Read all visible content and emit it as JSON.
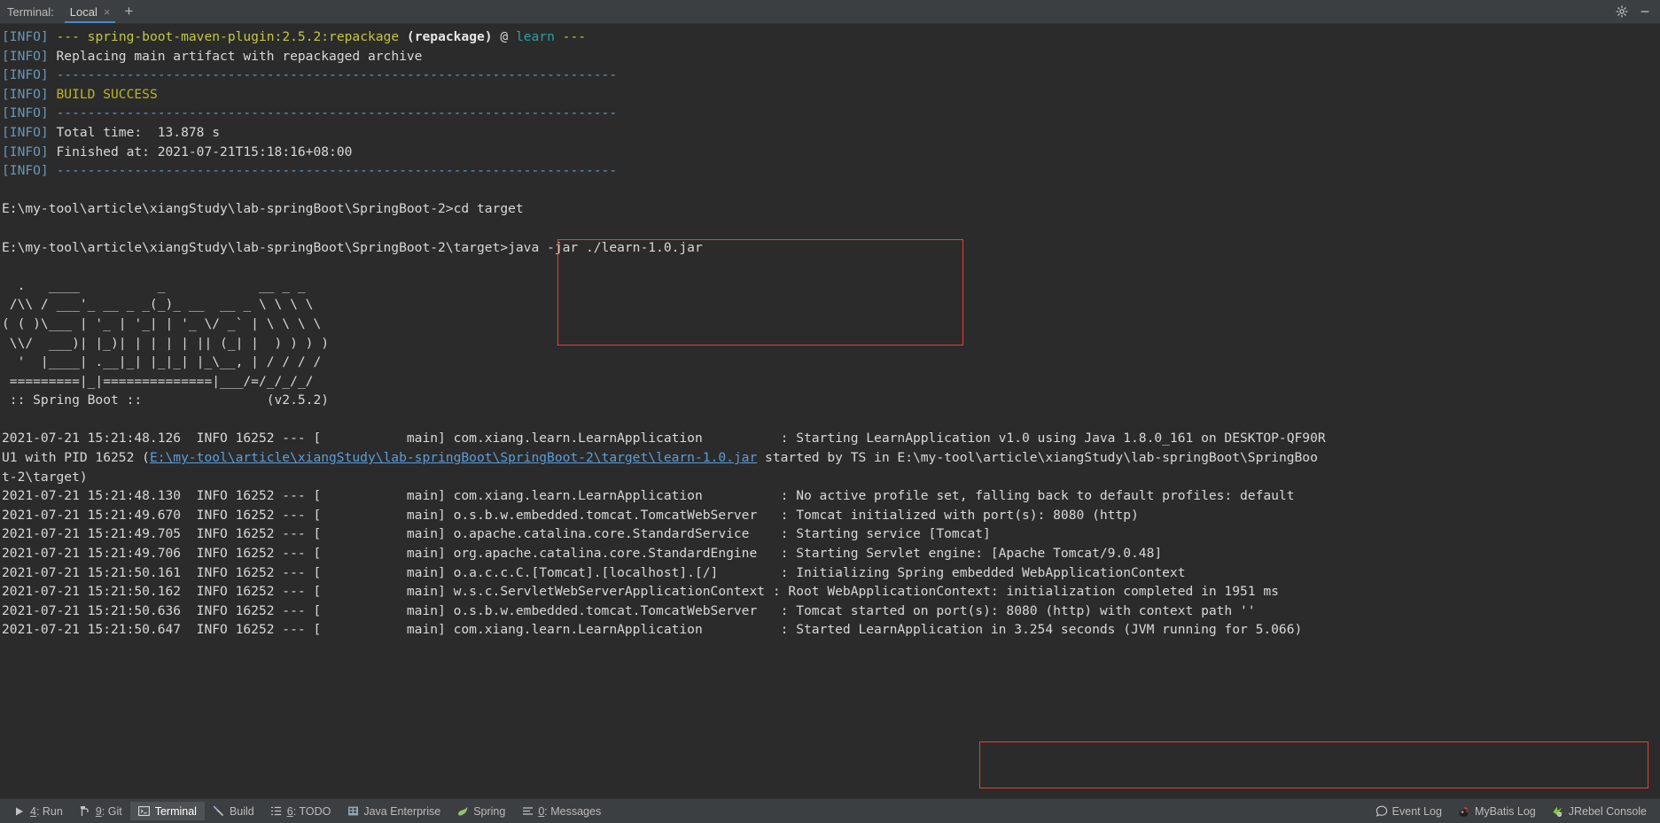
{
  "window": {
    "tabbar_label": "Terminal:",
    "tabs": [
      {
        "label": "Local",
        "close": "×",
        "active": true
      }
    ],
    "add_tab": "+",
    "settings_icon": "gear-icon",
    "minimize_icon": "minimize-icon"
  },
  "terminal": {
    "lines": [
      {
        "id": "l1",
        "segments": [
          {
            "t": "[INFO] ",
            "c": "c-info"
          },
          {
            "t": "--- ",
            "c": "c-plugin"
          },
          {
            "t": "spring-boot-maven-plugin:2.5.2:repackage",
            "c": "c-plugin"
          },
          {
            "t": " ",
            "c": "c-white"
          },
          {
            "t": "(repackage)",
            "c": "c-bold"
          },
          {
            "t": " @ ",
            "c": "c-white"
          },
          {
            "t": "learn",
            "c": "c-cyan"
          },
          {
            "t": " ---",
            "c": "c-plugin"
          }
        ]
      },
      {
        "id": "l2",
        "segments": [
          {
            "t": "[INFO] ",
            "c": "c-info"
          },
          {
            "t": "Replacing main artifact with repackaged archive",
            "c": "c-white"
          }
        ]
      },
      {
        "id": "l3",
        "segments": [
          {
            "t": "[INFO] ",
            "c": "c-info"
          },
          {
            "t": "------------------------------------------------------------------------",
            "c": "c-dash"
          }
        ]
      },
      {
        "id": "l4",
        "segments": [
          {
            "t": "[INFO] ",
            "c": "c-info"
          },
          {
            "t": "BUILD SUCCESS",
            "c": "c-yellow"
          }
        ]
      },
      {
        "id": "l5",
        "segments": [
          {
            "t": "[INFO] ",
            "c": "c-info"
          },
          {
            "t": "------------------------------------------------------------------------",
            "c": "c-dash"
          }
        ]
      },
      {
        "id": "l6",
        "segments": [
          {
            "t": "[INFO] ",
            "c": "c-info"
          },
          {
            "t": "Total time:  13.878 s",
            "c": "c-white"
          }
        ]
      },
      {
        "id": "l7",
        "segments": [
          {
            "t": "[INFO] ",
            "c": "c-info"
          },
          {
            "t": "Finished at: 2021-07-21T15:18:16+08:00",
            "c": "c-white"
          }
        ]
      },
      {
        "id": "l8",
        "segments": [
          {
            "t": "[INFO] ",
            "c": "c-info"
          },
          {
            "t": "------------------------------------------------------------------------",
            "c": "c-dash"
          }
        ]
      },
      {
        "id": "l9",
        "segments": [
          {
            "t": "",
            "c": "c-white"
          }
        ]
      },
      {
        "id": "l10",
        "segments": [
          {
            "t": "E:\\my-tool\\article\\xiangStudy\\lab-springBoot\\SpringBoot-2>cd target",
            "c": "c-white"
          }
        ]
      },
      {
        "id": "l11",
        "segments": [
          {
            "t": "",
            "c": "c-white"
          }
        ]
      },
      {
        "id": "l12",
        "segments": [
          {
            "t": "E:\\my-tool\\article\\xiangStudy\\lab-springBoot\\SpringBoot-2\\target>java -jar ./learn-1.0.jar",
            "c": "c-white"
          }
        ]
      },
      {
        "id": "l13",
        "segments": [
          {
            "t": "",
            "c": "c-white"
          }
        ]
      },
      {
        "id": "l14",
        "segments": [
          {
            "t": "  .   ____          _            __ _ _",
            "c": "c-white"
          }
        ]
      },
      {
        "id": "l15",
        "segments": [
          {
            "t": " /\\\\ / ___'_ __ _ _(_)_ __  __ _ \\ \\ \\ \\",
            "c": "c-white"
          }
        ]
      },
      {
        "id": "l16",
        "segments": [
          {
            "t": "( ( )\\___ | '_ | '_| | '_ \\/ _` | \\ \\ \\ \\",
            "c": "c-white"
          }
        ]
      },
      {
        "id": "l17",
        "segments": [
          {
            "t": " \\\\/  ___)| |_)| | | | | || (_| |  ) ) ) )",
            "c": "c-white"
          }
        ]
      },
      {
        "id": "l18",
        "segments": [
          {
            "t": "  '  |____| .__|_| |_|_| |_\\__, | / / / /",
            "c": "c-white"
          }
        ]
      },
      {
        "id": "l19",
        "segments": [
          {
            "t": " =========|_|==============|___/=/_/_/_/",
            "c": "c-white"
          }
        ]
      },
      {
        "id": "l20",
        "segments": [
          {
            "t": " :: Spring Boot ::                (v2.5.2)",
            "c": "c-white"
          }
        ]
      },
      {
        "id": "l21",
        "segments": [
          {
            "t": "",
            "c": "c-white"
          }
        ]
      },
      {
        "id": "l22",
        "segments": [
          {
            "t": "2021-07-21 15:21:48.126  INFO 16252 --- [           main] com.xiang.learn.LearnApplication          : Starting LearnApplication v1.0 using Java 1.8.0_161 on DESKTOP-QF90R",
            "c": "c-white"
          }
        ]
      },
      {
        "id": "l23",
        "segments": [
          {
            "t": "U1 with PID 16252 (",
            "c": "c-white"
          },
          {
            "t": "E:\\my-tool\\article\\xiangStudy\\lab-springBoot\\SpringBoot-2\\target\\learn-1.0.jar",
            "c": "c-link"
          },
          {
            "t": " started by TS in E:\\my-tool\\article\\xiangStudy\\lab-springBoot\\SpringBoo",
            "c": "c-white"
          }
        ]
      },
      {
        "id": "l24",
        "segments": [
          {
            "t": "t-2\\target)",
            "c": "c-white"
          }
        ]
      },
      {
        "id": "l25",
        "segments": [
          {
            "t": "2021-07-21 15:21:48.130  INFO 16252 --- [           main] com.xiang.learn.LearnApplication          : No active profile set, falling back to default profiles: default",
            "c": "c-white"
          }
        ]
      },
      {
        "id": "l26",
        "segments": [
          {
            "t": "2021-07-21 15:21:49.670  INFO 16252 --- [           main] o.s.b.w.embedded.tomcat.TomcatWebServer   : Tomcat initialized with port(s): 8080 (http)",
            "c": "c-white"
          }
        ]
      },
      {
        "id": "l27",
        "segments": [
          {
            "t": "2021-07-21 15:21:49.705  INFO 16252 --- [           main] o.apache.catalina.core.StandardService    : Starting service [Tomcat]",
            "c": "c-white"
          }
        ]
      },
      {
        "id": "l28",
        "segments": [
          {
            "t": "2021-07-21 15:21:49.706  INFO 16252 --- [           main] org.apache.catalina.core.StandardEngine   : Starting Servlet engine: [Apache Tomcat/9.0.48]",
            "c": "c-white"
          }
        ]
      },
      {
        "id": "l29",
        "segments": [
          {
            "t": "2021-07-21 15:21:50.161  INFO 16252 --- [           main] o.a.c.c.C.[Tomcat].[localhost].[/]        : Initializing Spring embedded WebApplicationContext",
            "c": "c-white"
          }
        ]
      },
      {
        "id": "l30",
        "segments": [
          {
            "t": "2021-07-21 15:21:50.162  INFO 16252 --- [           main] w.s.c.ServletWebServerApplicationContext : Root WebApplicationContext: initialization completed in 1951 ms",
            "c": "c-white"
          }
        ]
      },
      {
        "id": "l31",
        "segments": [
          {
            "t": "2021-07-21 15:21:50.636  INFO 16252 --- [           main] o.s.b.w.embedded.tomcat.TomcatWebServer   : Tomcat started on port(s): 8080 (http) with context path ''",
            "c": "c-white"
          }
        ]
      },
      {
        "id": "l32",
        "segments": [
          {
            "t": "2021-07-21 15:21:50.647  INFO 16252 --- [           main] com.xiang.learn.LearnApplication          : Started LearnApplication in 3.254 seconds (JVM running for 5.066)",
            "c": "c-white"
          }
        ]
      }
    ],
    "annotations": [
      {
        "name": "command-highlight-box",
        "color": "#e34234"
      },
      {
        "name": "startup-log-highlight-box",
        "color": "#e34234"
      }
    ]
  },
  "statusbar": {
    "left_items": [
      {
        "icon": "run-icon",
        "mnemonic": "4",
        "label": ": Run",
        "active": false
      },
      {
        "icon": "git-branch-icon",
        "mnemonic": "9",
        "label": ": Git",
        "active": false
      },
      {
        "icon": "terminal-icon",
        "mnemonic": "",
        "label": "Terminal",
        "active": true
      },
      {
        "icon": "hammer-icon",
        "mnemonic": "",
        "label": "Build",
        "active": false
      },
      {
        "icon": "checklist-icon",
        "mnemonic": "6",
        "label": ": TODO",
        "active": false
      },
      {
        "icon": "java-enterprise-icon",
        "mnemonic": "",
        "label": "Java Enterprise",
        "active": false
      },
      {
        "icon": "spring-leaf-icon",
        "mnemonic": "",
        "label": "Spring",
        "active": false
      },
      {
        "icon": "messages-icon",
        "mnemonic": "0",
        "label": ": Messages",
        "active": false
      }
    ],
    "right_items": [
      {
        "icon": "event-log-icon",
        "label": "Event Log"
      },
      {
        "icon": "mybatis-icon",
        "label": "MyBatis Log"
      },
      {
        "icon": "jrebel-icon",
        "label": "JRebel Console"
      }
    ]
  },
  "colors": {
    "background": "#2b2b2b",
    "chrome": "#3c3f41",
    "accent": "#4a88c7",
    "annotation": "#e34234",
    "info": "#6897bb",
    "success": "#bbb529",
    "plugin": "#c0c93f",
    "link": "#5c9ddb"
  }
}
